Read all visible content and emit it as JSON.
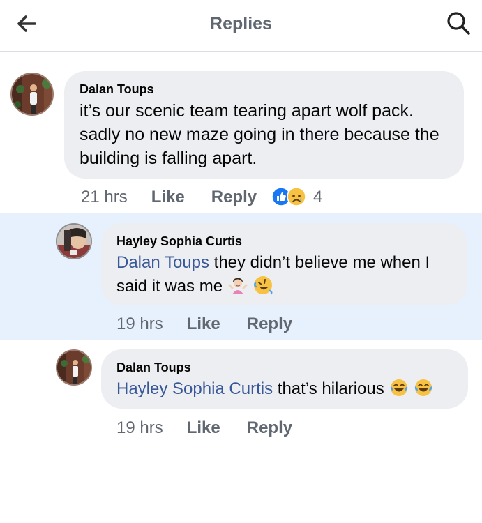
{
  "header": {
    "title": "Replies",
    "back_icon": "arrow-left-icon",
    "search_icon": "search-icon"
  },
  "comments": [
    {
      "author": "Dalan Toups",
      "mention": "",
      "text": "it’s our scenic team tearing apart wolf pack. sadly no new maze going in there because the building is falling apart.",
      "time": "21 hrs",
      "like_label": "Like",
      "reply_label": "Reply",
      "reactions": [
        "like",
        "sad"
      ],
      "reaction_count": "4"
    },
    {
      "author": "Hayley Sophia Curtis",
      "mention": "Dalan Toups",
      "text_line1": " they didn’t believe me when I",
      "text_line2": "said it was me",
      "emojis": [
        "person-shrugging",
        "rolling-on-floor-laughing"
      ],
      "time": "19 hrs",
      "like_label": "Like",
      "reply_label": "Reply",
      "highlighted": true
    },
    {
      "author": "Dalan Toups",
      "mention": "Hayley Sophia Curtis",
      "text": " that’s hilarious",
      "emojis": [
        "face-with-tears-of-joy",
        "face-with-tears-of-joy"
      ],
      "time": "19 hrs",
      "like_label": "Like",
      "reply_label": "Reply"
    }
  ],
  "colors": {
    "header_text": "#606770",
    "bubble_bg": "#edeef1",
    "mention": "#385898",
    "highlight_bg": "#e7f0fd",
    "meta_text": "#606770",
    "like_blue": "#1877f2"
  }
}
